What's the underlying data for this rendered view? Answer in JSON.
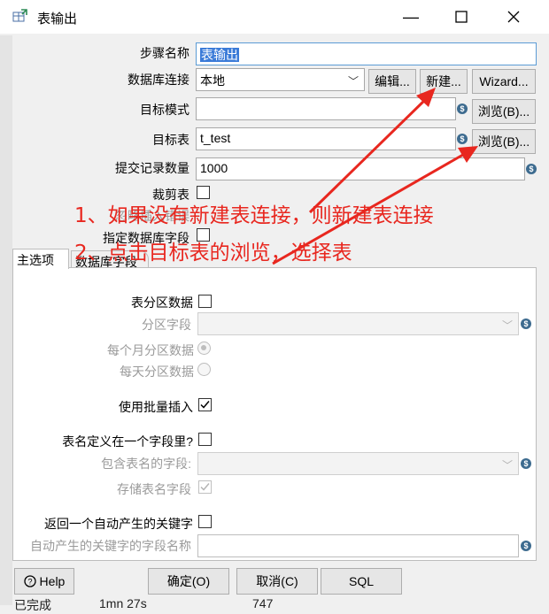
{
  "window": {
    "title": "表输出",
    "minimize_icon": "minimize-icon",
    "maximize_icon": "maximize-icon",
    "close_icon": "close-icon"
  },
  "form": {
    "step_name_label": "步骤名称",
    "step_name_value": "表输出",
    "db_conn_label": "数据库连接",
    "db_conn_value": "本地",
    "edit_btn": "编辑...",
    "new_btn": "新建...",
    "wizard_btn": "Wizard...",
    "target_schema_label": "目标模式",
    "target_schema_value": "",
    "browse_btn": "浏览(B)...",
    "target_table_label": "目标表",
    "target_table_value": "t_test",
    "commit_size_label": "提交记录数量",
    "commit_size_value": "1000",
    "truncate_label": "裁剪表",
    "ignore_errors_label": "忽略插入错误",
    "specify_fields_label": "指定数据库字段"
  },
  "tabs": [
    {
      "label": "主选项"
    },
    {
      "label": "数据库字段"
    }
  ],
  "main_tab": {
    "partition_label": "表分区数据",
    "partition_field_label": "分区字段",
    "monthly_label": "每个月分区数据",
    "daily_label": "每天分区数据",
    "batch_label": "使用批量插入",
    "table_in_field_label": "表名定义在一个字段里?",
    "table_name_field_label": "包含表名的字段:",
    "store_table_name_label": "存储表名字段",
    "return_key_label": "返回一个自动产生的关键字",
    "key_field_label": "自动产生的关键字的字段名称"
  },
  "footer": {
    "help_btn": "Help",
    "ok_btn": "确定(O)",
    "cancel_btn": "取消(C)",
    "sql_btn": "SQL"
  },
  "annotations": {
    "line1": "1、如果没有新建表连接，则新建表连接",
    "line2": "2、点击目标表的浏览，选择表"
  },
  "background": {
    "status_text": "已完成",
    "duration_text": "1mn 27s",
    "count_text": "747"
  },
  "colors": {
    "annotation": "#e8271f",
    "selection": "#3b7bd8",
    "focus_border": "#5b9bd5"
  }
}
